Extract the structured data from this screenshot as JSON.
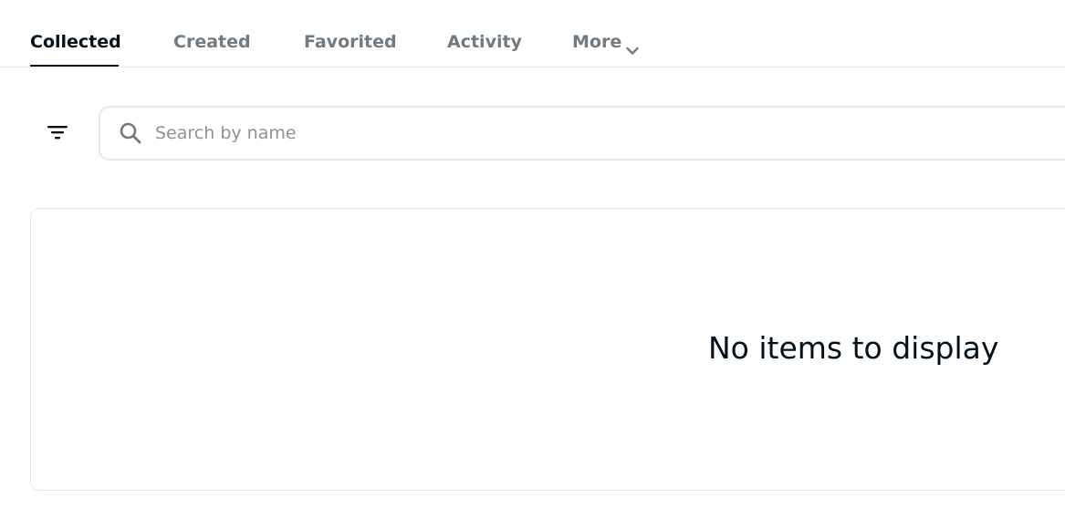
{
  "tabs": [
    {
      "label": "Collected",
      "active": true
    },
    {
      "label": "Created",
      "active": false
    },
    {
      "label": "Favorited",
      "active": false
    },
    {
      "label": "Activity",
      "active": false
    },
    {
      "label": "More",
      "active": false,
      "icon": "chevron-down-icon"
    }
  ],
  "toolbar": {
    "filter_icon": "filter-icon",
    "search": {
      "icon": "search-icon",
      "placeholder": "Search by name",
      "value": ""
    }
  },
  "results": {
    "empty_message": "No items to display"
  },
  "colors": {
    "text_primary": "#04111d",
    "text_secondary": "#707a83",
    "border": "#e5e8eb",
    "placeholder": "#8a939b"
  }
}
